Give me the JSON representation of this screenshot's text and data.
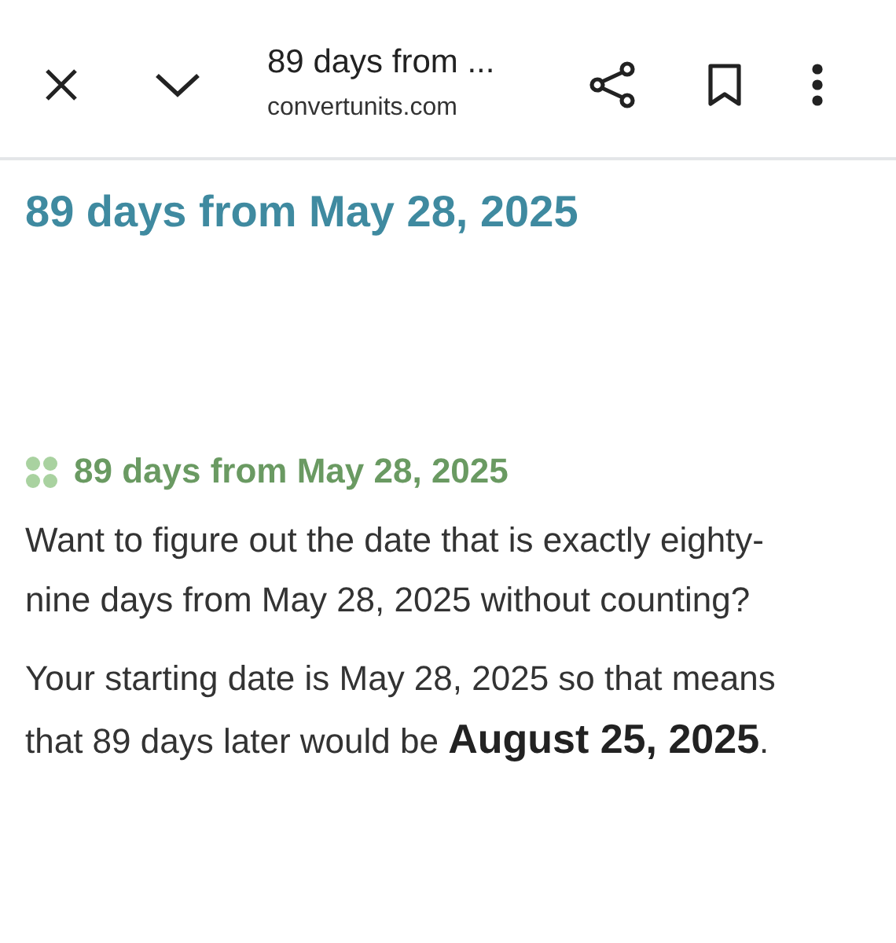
{
  "toolbar": {
    "title": "89 days from ...",
    "url": "convertunits.com"
  },
  "heading": "89 days from May 28, 2025",
  "subheading": "89 days from May 28, 2025",
  "paragraphs": [
    "Want to figure out the date that is exactly eighty-nine days from May 28, 2025 without counting?",
    "Your starting date is May 28, 2025 so that means that 89 days later would be **August 25, 2025**."
  ]
}
